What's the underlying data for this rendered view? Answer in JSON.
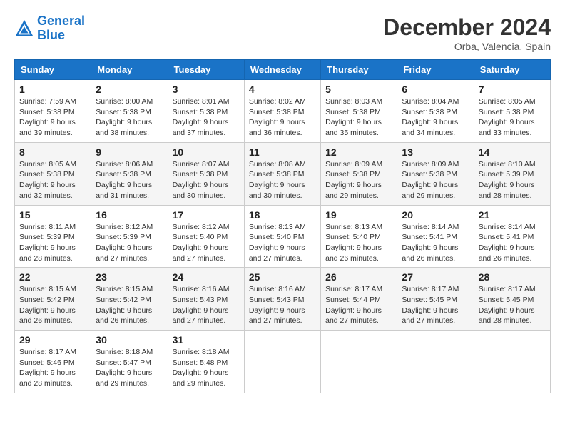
{
  "header": {
    "logo_line1": "General",
    "logo_line2": "Blue",
    "month": "December 2024",
    "location": "Orba, Valencia, Spain"
  },
  "weekdays": [
    "Sunday",
    "Monday",
    "Tuesday",
    "Wednesday",
    "Thursday",
    "Friday",
    "Saturday"
  ],
  "weeks": [
    [
      {
        "day": "1",
        "sunrise": "7:59 AM",
        "sunset": "5:38 PM",
        "daylight": "9 hours and 39 minutes."
      },
      {
        "day": "2",
        "sunrise": "8:00 AM",
        "sunset": "5:38 PM",
        "daylight": "9 hours and 38 minutes."
      },
      {
        "day": "3",
        "sunrise": "8:01 AM",
        "sunset": "5:38 PM",
        "daylight": "9 hours and 37 minutes."
      },
      {
        "day": "4",
        "sunrise": "8:02 AM",
        "sunset": "5:38 PM",
        "daylight": "9 hours and 36 minutes."
      },
      {
        "day": "5",
        "sunrise": "8:03 AM",
        "sunset": "5:38 PM",
        "daylight": "9 hours and 35 minutes."
      },
      {
        "day": "6",
        "sunrise": "8:04 AM",
        "sunset": "5:38 PM",
        "daylight": "9 hours and 34 minutes."
      },
      {
        "day": "7",
        "sunrise": "8:05 AM",
        "sunset": "5:38 PM",
        "daylight": "9 hours and 33 minutes."
      }
    ],
    [
      {
        "day": "8",
        "sunrise": "8:05 AM",
        "sunset": "5:38 PM",
        "daylight": "9 hours and 32 minutes."
      },
      {
        "day": "9",
        "sunrise": "8:06 AM",
        "sunset": "5:38 PM",
        "daylight": "9 hours and 31 minutes."
      },
      {
        "day": "10",
        "sunrise": "8:07 AM",
        "sunset": "5:38 PM",
        "daylight": "9 hours and 30 minutes."
      },
      {
        "day": "11",
        "sunrise": "8:08 AM",
        "sunset": "5:38 PM",
        "daylight": "9 hours and 30 minutes."
      },
      {
        "day": "12",
        "sunrise": "8:09 AM",
        "sunset": "5:38 PM",
        "daylight": "9 hours and 29 minutes."
      },
      {
        "day": "13",
        "sunrise": "8:09 AM",
        "sunset": "5:38 PM",
        "daylight": "9 hours and 29 minutes."
      },
      {
        "day": "14",
        "sunrise": "8:10 AM",
        "sunset": "5:39 PM",
        "daylight": "9 hours and 28 minutes."
      }
    ],
    [
      {
        "day": "15",
        "sunrise": "8:11 AM",
        "sunset": "5:39 PM",
        "daylight": "9 hours and 28 minutes."
      },
      {
        "day": "16",
        "sunrise": "8:12 AM",
        "sunset": "5:39 PM",
        "daylight": "9 hours and 27 minutes."
      },
      {
        "day": "17",
        "sunrise": "8:12 AM",
        "sunset": "5:40 PM",
        "daylight": "9 hours and 27 minutes."
      },
      {
        "day": "18",
        "sunrise": "8:13 AM",
        "sunset": "5:40 PM",
        "daylight": "9 hours and 27 minutes."
      },
      {
        "day": "19",
        "sunrise": "8:13 AM",
        "sunset": "5:40 PM",
        "daylight": "9 hours and 26 minutes."
      },
      {
        "day": "20",
        "sunrise": "8:14 AM",
        "sunset": "5:41 PM",
        "daylight": "9 hours and 26 minutes."
      },
      {
        "day": "21",
        "sunrise": "8:14 AM",
        "sunset": "5:41 PM",
        "daylight": "9 hours and 26 minutes."
      }
    ],
    [
      {
        "day": "22",
        "sunrise": "8:15 AM",
        "sunset": "5:42 PM",
        "daylight": "9 hours and 26 minutes."
      },
      {
        "day": "23",
        "sunrise": "8:15 AM",
        "sunset": "5:42 PM",
        "daylight": "9 hours and 26 minutes."
      },
      {
        "day": "24",
        "sunrise": "8:16 AM",
        "sunset": "5:43 PM",
        "daylight": "9 hours and 27 minutes."
      },
      {
        "day": "25",
        "sunrise": "8:16 AM",
        "sunset": "5:43 PM",
        "daylight": "9 hours and 27 minutes."
      },
      {
        "day": "26",
        "sunrise": "8:17 AM",
        "sunset": "5:44 PM",
        "daylight": "9 hours and 27 minutes."
      },
      {
        "day": "27",
        "sunrise": "8:17 AM",
        "sunset": "5:45 PM",
        "daylight": "9 hours and 27 minutes."
      },
      {
        "day": "28",
        "sunrise": "8:17 AM",
        "sunset": "5:45 PM",
        "daylight": "9 hours and 28 minutes."
      }
    ],
    [
      {
        "day": "29",
        "sunrise": "8:17 AM",
        "sunset": "5:46 PM",
        "daylight": "9 hours and 28 minutes."
      },
      {
        "day": "30",
        "sunrise": "8:18 AM",
        "sunset": "5:47 PM",
        "daylight": "9 hours and 29 minutes."
      },
      {
        "day": "31",
        "sunrise": "8:18 AM",
        "sunset": "5:48 PM",
        "daylight": "9 hours and 29 minutes."
      },
      null,
      null,
      null,
      null
    ]
  ],
  "labels": {
    "sunrise": "Sunrise:",
    "sunset": "Sunset:",
    "daylight": "Daylight:"
  }
}
